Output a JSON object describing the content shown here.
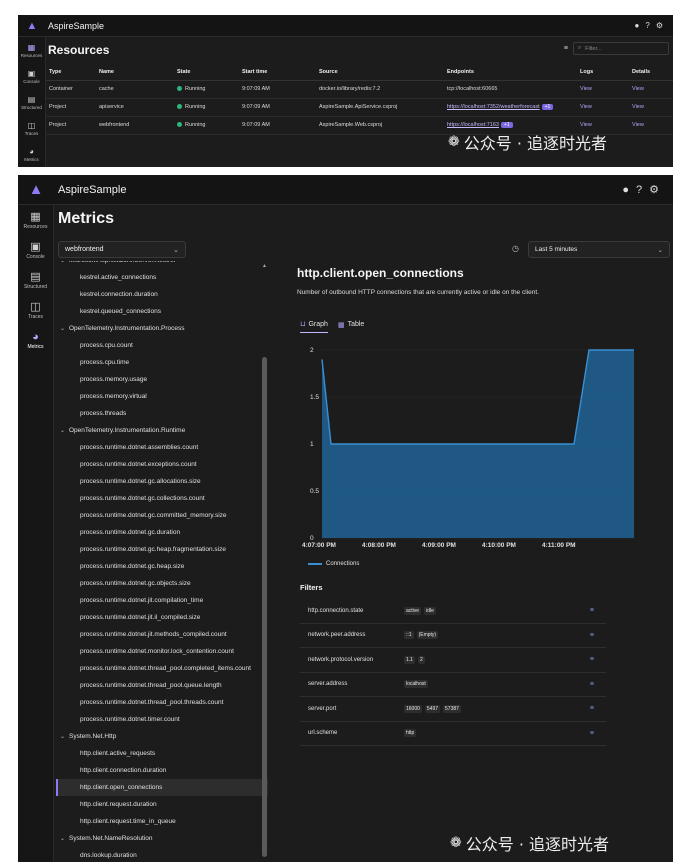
{
  "top": {
    "app_title": "AspireSample",
    "page_title": "Resources",
    "filter_placeholder": "Filter...",
    "rail": [
      {
        "label": "Resources",
        "icon": "grid-icon"
      },
      {
        "label": "Console",
        "icon": "console-icon"
      },
      {
        "label": "Structured",
        "icon": "structured-icon"
      },
      {
        "label": "Traces",
        "icon": "traces-icon"
      },
      {
        "label": "Metrics",
        "icon": "metrics-icon"
      }
    ],
    "columns": [
      "Type",
      "Name",
      "State",
      "Start time",
      "Source",
      "Endpoints",
      "Logs",
      "Details"
    ],
    "rows": [
      {
        "type": "Container",
        "name": "cache",
        "state": "Running",
        "start": "9:07:09 AM",
        "source": "docker.io/library/redis:7.2",
        "endpoint": "tcp://localhost:60665",
        "endpoint_link": false,
        "badge": "",
        "logs": "View",
        "details": "View"
      },
      {
        "type": "Project",
        "name": "apiservice",
        "state": "Running",
        "start": "9:07:09 AM",
        "source": "AspireSample.ApiService.csproj",
        "endpoint": "https://localhost:7352/weatherforecast",
        "endpoint_link": true,
        "badge": "+1",
        "logs": "View",
        "details": "View"
      },
      {
        "type": "Project",
        "name": "webfrontend",
        "state": "Running",
        "start": "9:07:09 AM",
        "source": "AspireSample.Web.csproj",
        "endpoint": "https://localhost:7163",
        "endpoint_link": true,
        "badge": "+1",
        "logs": "View",
        "details": "View"
      }
    ],
    "watermark": "公众号 · 追逐时光者"
  },
  "bottom": {
    "app_title": "AspireSample",
    "page_title": "Metrics",
    "resource_select": "webfrontend",
    "time_select": "Last 5 minutes",
    "rail": [
      {
        "label": "Resources",
        "icon": "grid-icon"
      },
      {
        "label": "Console",
        "icon": "console-icon"
      },
      {
        "label": "Structured",
        "icon": "structured-icon"
      },
      {
        "label": "Traces",
        "icon": "traces-icon"
      },
      {
        "label": "Metrics",
        "icon": "metrics-icon"
      }
    ],
    "tree": [
      {
        "kind": "group",
        "text": "Microsoft.AspNetCore.Server.Kestrel"
      },
      {
        "kind": "leaf",
        "text": "kestrel.active_connections"
      },
      {
        "kind": "leaf",
        "text": "kestrel.connection.duration"
      },
      {
        "kind": "leaf",
        "text": "kestrel.queued_connections"
      },
      {
        "kind": "group",
        "text": "OpenTelemetry.Instrumentation.Process"
      },
      {
        "kind": "leaf",
        "text": "process.cpu.count"
      },
      {
        "kind": "leaf",
        "text": "process.cpu.time"
      },
      {
        "kind": "leaf",
        "text": "process.memory.usage"
      },
      {
        "kind": "leaf",
        "text": "process.memory.virtual"
      },
      {
        "kind": "leaf",
        "text": "process.threads"
      },
      {
        "kind": "group",
        "text": "OpenTelemetry.Instrumentation.Runtime"
      },
      {
        "kind": "leaf",
        "text": "process.runtime.dotnet.assemblies.count"
      },
      {
        "kind": "leaf",
        "text": "process.runtime.dotnet.exceptions.count"
      },
      {
        "kind": "leaf",
        "text": "process.runtime.dotnet.gc.allocations.size"
      },
      {
        "kind": "leaf",
        "text": "process.runtime.dotnet.gc.collections.count"
      },
      {
        "kind": "leaf",
        "text": "process.runtime.dotnet.gc.committed_memory.size"
      },
      {
        "kind": "leaf",
        "text": "process.runtime.dotnet.gc.duration"
      },
      {
        "kind": "leaf",
        "text": "process.runtime.dotnet.gc.heap.fragmentation.size"
      },
      {
        "kind": "leaf",
        "text": "process.runtime.dotnet.gc.heap.size"
      },
      {
        "kind": "leaf",
        "text": "process.runtime.dotnet.gc.objects.size"
      },
      {
        "kind": "leaf",
        "text": "process.runtime.dotnet.jit.compilation_time"
      },
      {
        "kind": "leaf",
        "text": "process.runtime.dotnet.jit.il_compiled.size"
      },
      {
        "kind": "leaf",
        "text": "process.runtime.dotnet.jit.methods_compiled.count"
      },
      {
        "kind": "leaf",
        "text": "process.runtime.dotnet.monitor.lock_contention.count"
      },
      {
        "kind": "leaf",
        "text": "process.runtime.dotnet.thread_pool.completed_items.count"
      },
      {
        "kind": "leaf",
        "text": "process.runtime.dotnet.thread_pool.queue.length"
      },
      {
        "kind": "leaf",
        "text": "process.runtime.dotnet.thread_pool.threads.count"
      },
      {
        "kind": "leaf",
        "text": "process.runtime.dotnet.timer.count"
      },
      {
        "kind": "group",
        "text": "System.Net.Http"
      },
      {
        "kind": "leaf",
        "text": "http.client.active_requests"
      },
      {
        "kind": "leaf",
        "text": "http.client.connection.duration"
      },
      {
        "kind": "leaf",
        "text": "http.client.open_connections",
        "selected": true
      },
      {
        "kind": "leaf",
        "text": "http.client.request.duration"
      },
      {
        "kind": "leaf",
        "text": "http.client.request.time_in_queue"
      },
      {
        "kind": "group",
        "text": "System.Net.NameResolution"
      },
      {
        "kind": "leaf",
        "text": "dns.lookup.duration"
      }
    ],
    "metric_title": "http.client.open_connections",
    "metric_description": "Number of outbound HTTP connections that are currently active or idle on the client.",
    "tab_graph": "Graph",
    "tab_table": "Table",
    "filters_title": "Filters",
    "filters": [
      {
        "name": "http.connection.state",
        "values": [
          "active",
          "idle"
        ]
      },
      {
        "name": "network.peer.address",
        "values": [
          "::1",
          "(Empty)"
        ]
      },
      {
        "name": "network.protocol.version",
        "values": [
          "1.1",
          "2"
        ]
      },
      {
        "name": "server.address",
        "values": [
          "localhost"
        ]
      },
      {
        "name": "server.port",
        "values": [
          "16000",
          "5497",
          "57387"
        ]
      },
      {
        "name": "url.scheme",
        "values": [
          "http"
        ]
      }
    ],
    "watermark": "公众号 · 追逐时光者"
  },
  "chart_data": {
    "type": "area",
    "title": "",
    "x_ticks": [
      "4:07:00 PM",
      "4:08:00 PM",
      "4:09:00 PM",
      "4:10:00 PM",
      "4:11:00 PM"
    ],
    "x_minutes": [
      0,
      1,
      2,
      3,
      4
    ],
    "y_ticks": [
      "0",
      "0.5",
      "1",
      "1.5",
      "2"
    ],
    "ylim": [
      0,
      2
    ],
    "xlim": [
      0,
      5.2
    ],
    "series": [
      {
        "name": "Connections",
        "color": "#3a8fd3",
        "x": [
          0,
          0.15,
          4.2,
          4.45,
          5.2
        ],
        "y": [
          1.9,
          1,
          1,
          2,
          2
        ]
      }
    ],
    "grid": true,
    "legend": "bottom-left"
  }
}
